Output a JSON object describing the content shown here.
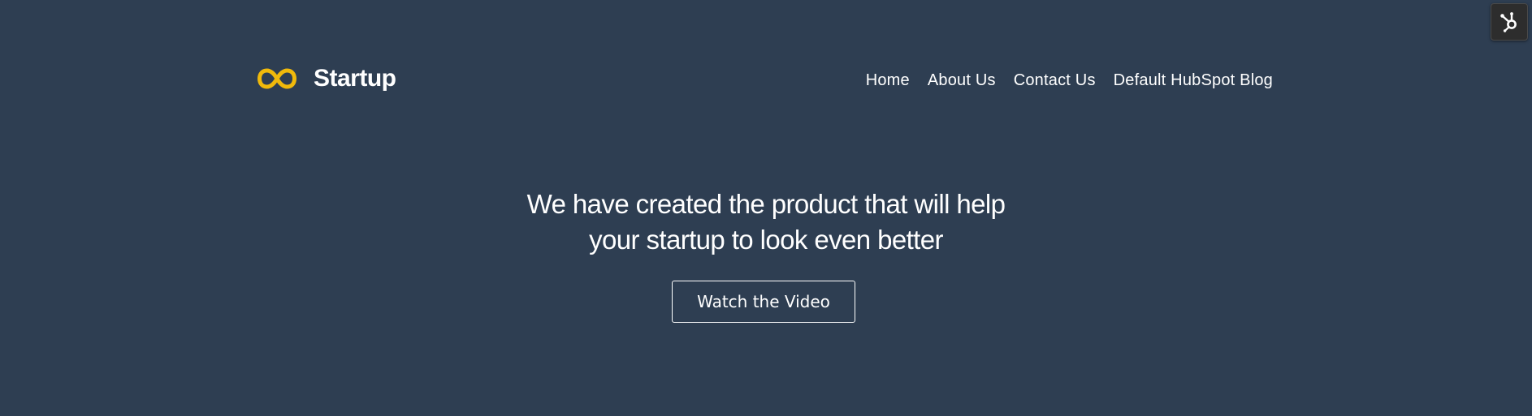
{
  "header": {
    "logo_text": "Startup",
    "logo_icon": "infinity-icon",
    "logo_color": "#f0b90b"
  },
  "nav": {
    "items": [
      {
        "label": "Home"
      },
      {
        "label": "About Us"
      },
      {
        "label": "Contact Us"
      },
      {
        "label": "Default HubSpot Blog"
      }
    ]
  },
  "hero": {
    "line1": "We have created the product that will help",
    "line2": "your startup to look even better",
    "cta_label": "Watch the Video"
  },
  "widgets": {
    "hubspot_icon": "hubspot-sprocket-icon"
  },
  "colors": {
    "background": "#2e3e52",
    "text": "#ffffff"
  }
}
